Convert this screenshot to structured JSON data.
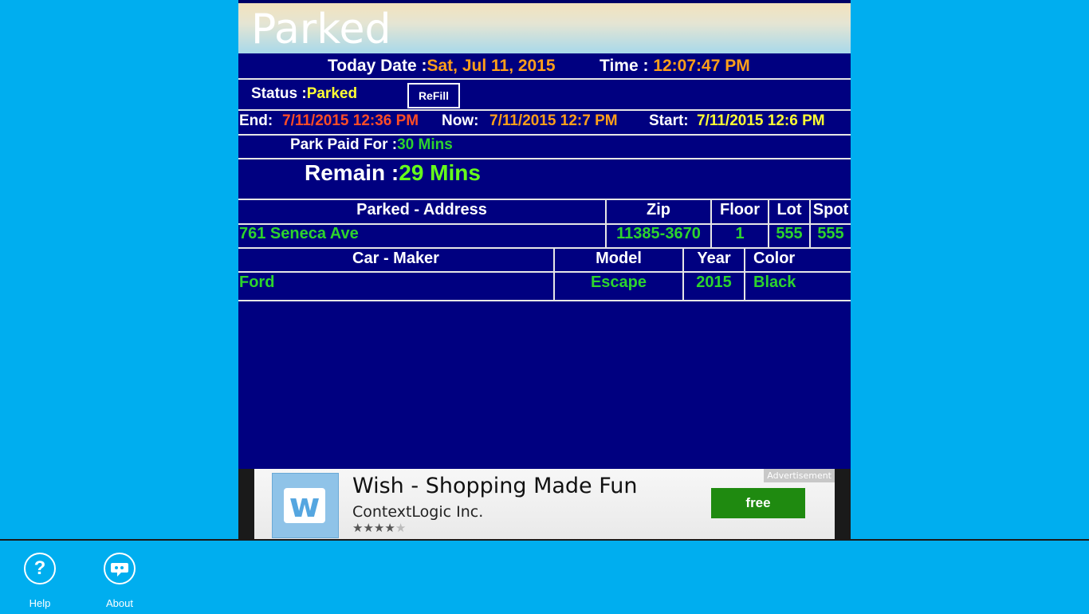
{
  "app": {
    "title": "Parked"
  },
  "date_row": {
    "date_label": "Today Date :",
    "date_value": "Sat, Jul 11, 2015",
    "time_label": "Time :",
    "time_value": "12:07:47 PM"
  },
  "status_row": {
    "status_label": "Status :",
    "status_value": "Parked",
    "refill_label": "ReFill"
  },
  "times_row": {
    "end_label": "End:",
    "end_value": "7/11/2015 12:36 PM",
    "now_label": "Now:",
    "now_value": "7/11/2015 12:7 PM",
    "start_label": "Start:",
    "start_value": "7/11/2015 12:6 PM"
  },
  "paid_row": {
    "label": "Park Paid For :",
    "value": "30 Mins"
  },
  "remain_row": {
    "label": "Remain :",
    "value": "29 Mins"
  },
  "address_table": {
    "headers": [
      "Parked - Address",
      "Zip",
      "Floor",
      "Lot",
      "Spot"
    ],
    "values": [
      "761 Seneca Ave",
      "11385-3670",
      "1",
      "555",
      "555"
    ]
  },
  "car_table": {
    "headers": [
      "Car - Maker",
      "Model",
      "Year",
      "Color"
    ],
    "values": [
      "Ford",
      "Escape",
      "2015",
      "Black"
    ]
  },
  "ad": {
    "title": "Wish - Shopping Made Fun",
    "publisher": "ContextLogic Inc.",
    "badge": "Advertisement",
    "button": "free",
    "rating": 4,
    "rating_max": 5,
    "logo_letter": "w"
  },
  "appbar": {
    "help_label": "Help",
    "about_label": "About",
    "help_icon": "question-icon",
    "about_icon": "chat-icon"
  },
  "colors": {
    "page_bg": "#00aeef",
    "panel_bg": "#000080",
    "orange": "#ff9f1a",
    "yellow": "#ffff33",
    "red": "#ff4d26",
    "green": "#2dd42d",
    "lime": "#66ff1a"
  }
}
